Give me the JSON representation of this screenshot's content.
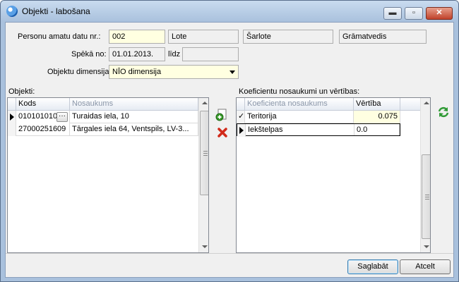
{
  "window": {
    "title": "Objekti - labošana",
    "min_glyph": "▬",
    "max_glyph": "▫",
    "close_glyph": "✕"
  },
  "form": {
    "position_label": "Personu amatu datu nr.:",
    "position_value": "002",
    "position_name1": "Lote",
    "position_name2": "Šarlote",
    "position_name3": "Grāmatvedis",
    "valid_from_label": "Spēkā no:",
    "valid_from_value": "01.01.2013.",
    "valid_to_label": "līdz",
    "valid_to_value": "",
    "dimension_label": "Objektu dimensija:",
    "dimension_value": "NĪO dimensija"
  },
  "objects": {
    "label": "Objekti:",
    "columns": [
      "Kods",
      "Nosaukums"
    ],
    "rows": [
      {
        "code": "010101010",
        "name": "Turaidas iela, 10"
      },
      {
        "code": "27000251609",
        "name": "Tārgales iela 64, Ventspils, LV-3..."
      }
    ],
    "ellipsis": "···"
  },
  "coeff": {
    "label": "Koeficientu nosaukumi un vērtības:",
    "columns": [
      "Koeficienta nosaukums",
      "Vērtība"
    ],
    "rows": [
      {
        "mark": "✓",
        "name": "Teritorija",
        "value": "0.075"
      },
      {
        "mark": "",
        "name": "Iekštelpas",
        "value": "0.0"
      }
    ]
  },
  "icons": {
    "add": "add-icon",
    "delete": "delete-icon",
    "refresh": "refresh-icon"
  },
  "buttons": {
    "save": "Saglabāt",
    "cancel": "Atcelt"
  },
  "colors": {
    "required_field": "#ffffe1",
    "row_highlight": "#ffffe1",
    "title_bar": "#a9c1dd"
  }
}
